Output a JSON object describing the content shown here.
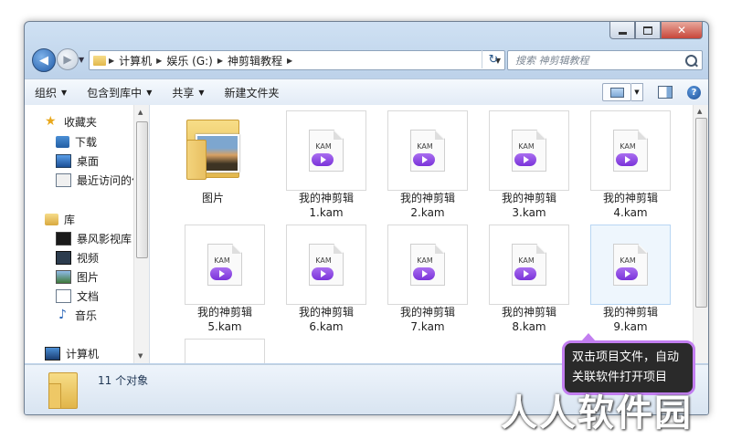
{
  "nav": {
    "breadcrumbs": [
      "计算机",
      "娱乐 (G:)",
      "神剪辑教程"
    ],
    "search_placeholder": "搜索 神剪辑教程"
  },
  "toolbar": {
    "organize": "组织",
    "include_in_library": "包含到库中",
    "share": "共享",
    "new_folder": "新建文件夹"
  },
  "sidebar": {
    "favorites": "收藏夹",
    "downloads": "下载",
    "desktop": "桌面",
    "recent": "最近访问的位置",
    "libraries": "库",
    "storm_library": "暴风影视库",
    "videos": "视频",
    "pictures": "图片",
    "documents": "文档",
    "music": "音乐",
    "computer": "计算机"
  },
  "files": {
    "folder_name": "图片",
    "ext_label": "KAM",
    "items": [
      {
        "line1": "我的神剪辑",
        "line2": "1.kam"
      },
      {
        "line1": "我的神剪辑",
        "line2": "2.kam"
      },
      {
        "line1": "我的神剪辑",
        "line2": "3.kam"
      },
      {
        "line1": "我的神剪辑",
        "line2": "4.kam"
      },
      {
        "line1": "我的神剪辑",
        "line2": "5.kam"
      },
      {
        "line1": "我的神剪辑",
        "line2": "6.kam"
      },
      {
        "line1": "我的神剪辑",
        "line2": "7.kam"
      },
      {
        "line1": "我的神剪辑",
        "line2": "8.kam"
      },
      {
        "line1": "我的神剪辑",
        "line2": "9.kam"
      }
    ]
  },
  "status": {
    "object_count": "11 个对象"
  },
  "tooltip": {
    "line1": "双击项目文件，自动",
    "line2": "关联软件打开项目"
  },
  "watermark": "人人软件园",
  "colors": {
    "accent_purple": "#8b3fe0",
    "window_frame": "#bdd2ea"
  }
}
